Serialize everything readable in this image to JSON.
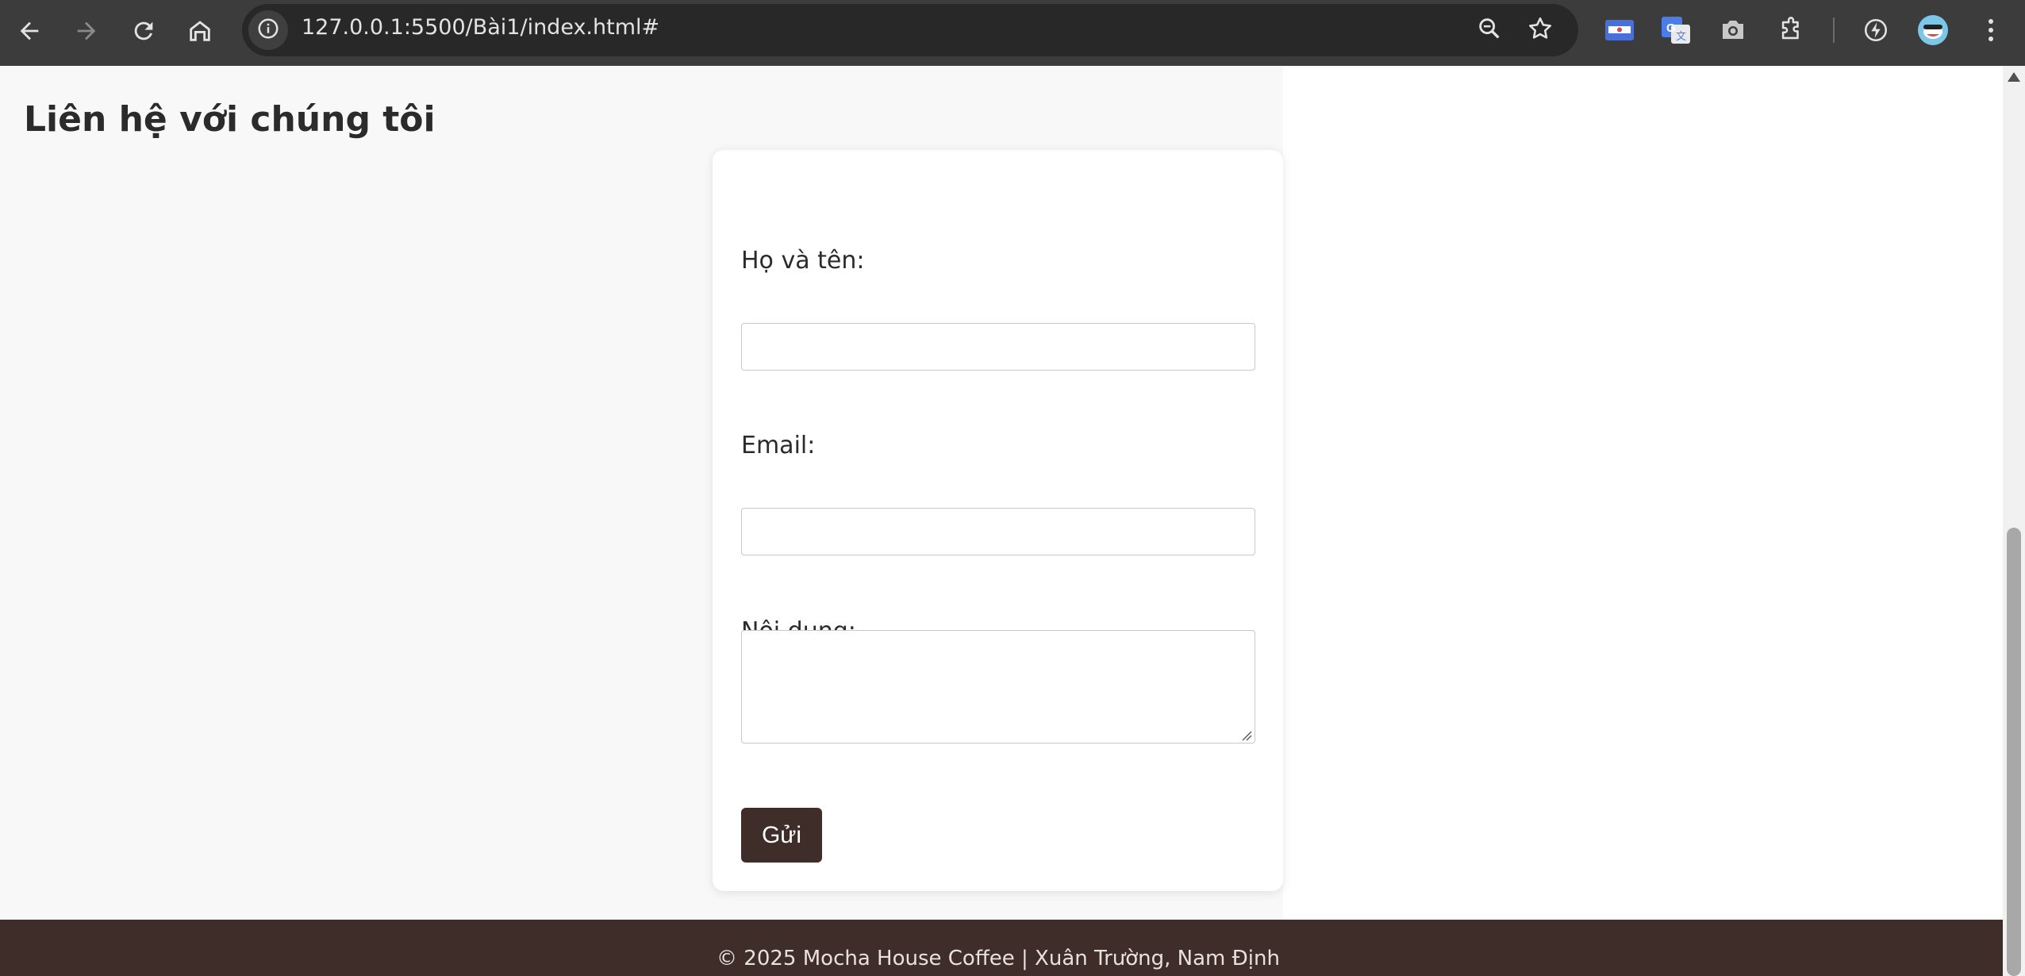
{
  "browser": {
    "url": "127.0.0.1:5500/Bài1/index.html#",
    "icons": {
      "back": "back-arrow-icon",
      "forward": "forward-arrow-icon",
      "reload": "reload-icon",
      "home": "home-icon",
      "site_info": "info-icon",
      "zoom": "zoom-icon",
      "bookmark": "star-icon",
      "extensions": [
        "tickets-extension-icon",
        "google-translate-icon",
        "camera-icon",
        "puzzle-icon",
        "performance-icon",
        "profile-avatar-icon",
        "menu-dots-icon"
      ]
    }
  },
  "page": {
    "title": "Liên hệ với chúng tôi",
    "form": {
      "name_label": "Họ và tên:",
      "name_value": "",
      "email_label": "Email:",
      "email_value": "",
      "message_label": "Nội dung:",
      "message_value": "",
      "submit_label": "Gửi"
    },
    "footer": "© 2025 Mocha House Coffee | Xuân Trường, Nam Định"
  },
  "colors": {
    "brand_dark": "#3e2d28",
    "page_bg": "#f8f8f8",
    "card_bg": "#ffffff",
    "chrome_bg": "#3c3c3c"
  }
}
